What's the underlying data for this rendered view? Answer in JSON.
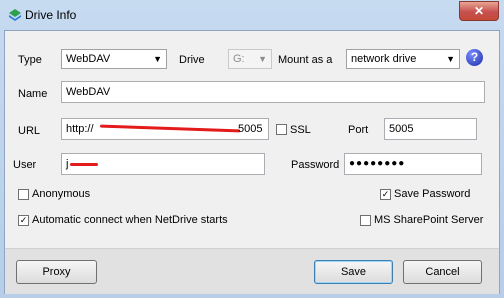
{
  "window": {
    "title": "Drive Info",
    "close_glyph": "✕"
  },
  "form": {
    "type_label": "Type",
    "type_value": "WebDAV",
    "drive_label": "Drive",
    "drive_value": "G:",
    "mount_label": "Mount as a",
    "mount_value": "network drive",
    "help_glyph": "?",
    "name_label": "Name",
    "name_value": "WebDAV",
    "url_label": "URL",
    "url_value_start": "http://",
    "url_value_end": "5005",
    "ssl_label": "SSL",
    "port_label": "Port",
    "port_value": "5005",
    "user_label": "User",
    "user_value_start": "j",
    "password_label": "Password",
    "password_value": "●●●●●●●●",
    "anonymous_label": "Anonymous",
    "save_password_label": "Save Password",
    "auto_connect_label": "Automatic connect when NetDrive starts",
    "sharepoint_label": "MS SharePoint Server"
  },
  "checkboxes": {
    "ssl": false,
    "anonymous": false,
    "save_password": true,
    "auto_connect": true,
    "sharepoint": false
  },
  "footer": {
    "proxy_label": "Proxy",
    "save_label": "Save",
    "cancel_label": "Cancel"
  },
  "colors": {
    "accent": "#3399ff",
    "redaction": "#e31b1b"
  }
}
